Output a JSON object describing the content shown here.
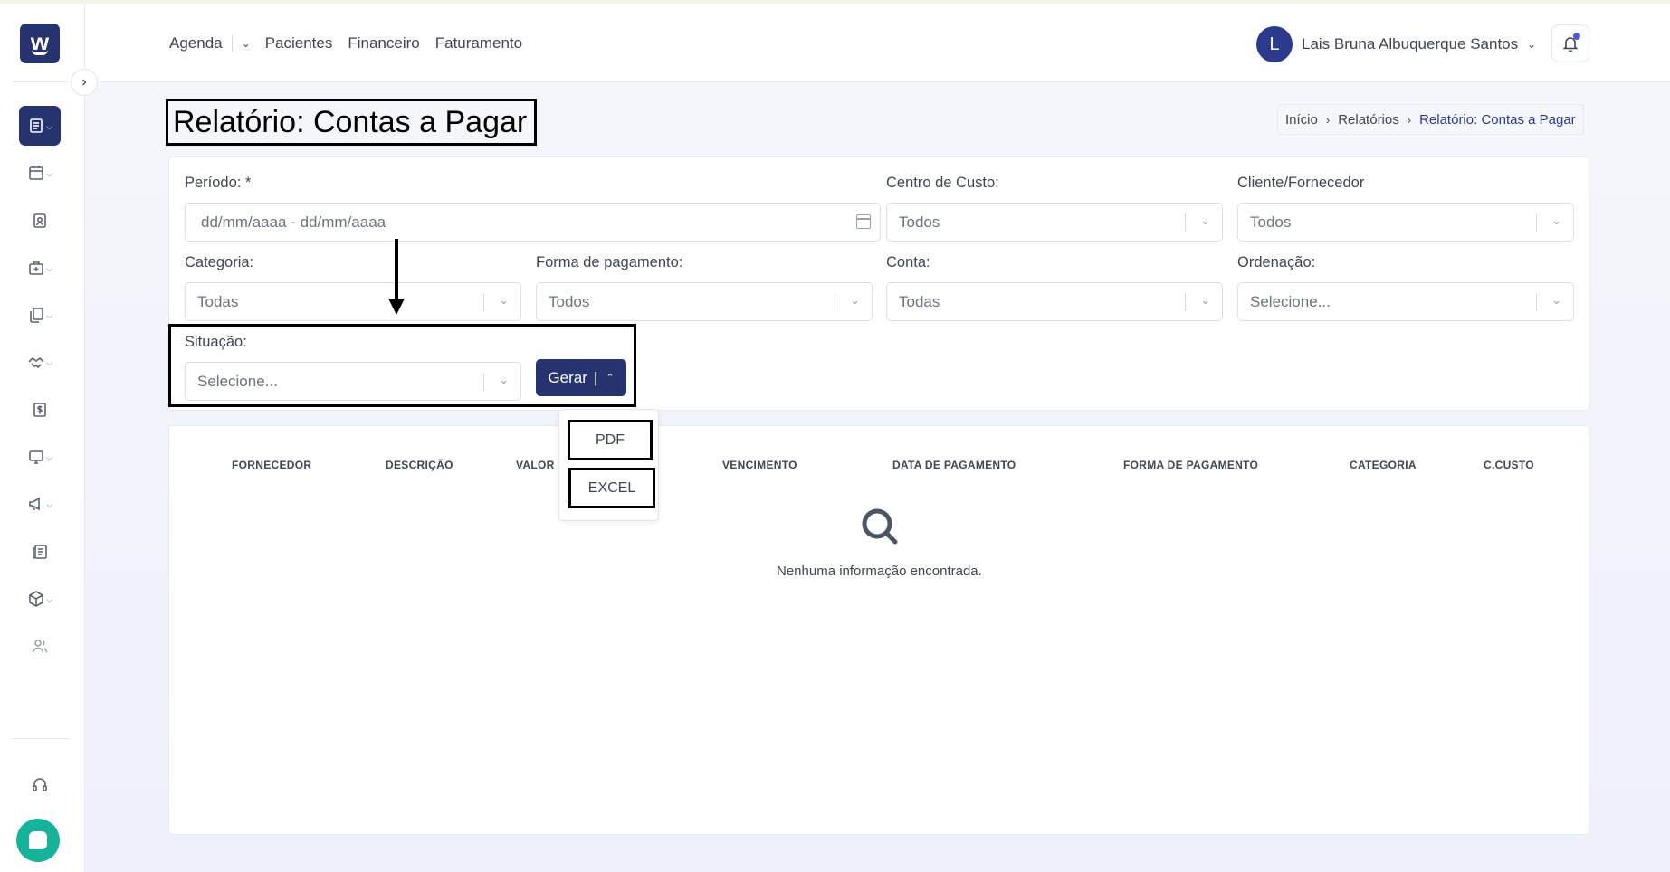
{
  "topnav": {
    "agenda": "Agenda",
    "pacientes": "Pacientes",
    "financeiro": "Financeiro",
    "faturamento": "Faturamento"
  },
  "user": {
    "initial": "L",
    "name": "Lais Bruna Albuquerque Santos"
  },
  "page": {
    "title": "Relatório: Contas a Pagar"
  },
  "breadcrumb": {
    "home": "Início",
    "reports": "Relatórios",
    "current": "Relatório: Contas a Pagar"
  },
  "filters": {
    "periodo": {
      "label": "Período: *",
      "placeholder": "dd/mm/aaaa - dd/mm/aaaa"
    },
    "centro_custo": {
      "label": "Centro de Custo:",
      "value": "Todos"
    },
    "cliente_fornecedor": {
      "label": "Cliente/Fornecedor",
      "value": "Todos"
    },
    "categoria": {
      "label": "Categoria:",
      "value": "Todas"
    },
    "forma_pagamento": {
      "label": "Forma de pagamento:",
      "value": "Todos"
    },
    "conta": {
      "label": "Conta:",
      "value": "Todas"
    },
    "ordenacao": {
      "label": "Ordenação:",
      "value": "Selecione..."
    },
    "situacao": {
      "label": "Situação:",
      "value": "Selecione..."
    }
  },
  "gerar": {
    "label": "Gerar",
    "options": [
      "PDF",
      "EXCEL"
    ]
  },
  "table": {
    "columns": [
      "FORNECEDOR",
      "DESCRIÇÃO",
      "VALOR",
      "VENCIMENTO",
      "DATA DE PAGAMENTO",
      "FORMA DE PAGAMENTO",
      "CATEGORIA",
      "C.CUSTO"
    ],
    "empty": "Nenhuma informação encontrada."
  },
  "colors": {
    "primary": "#26336e",
    "chat": "#15b39a",
    "notification_dot": "#4f5bd5"
  }
}
